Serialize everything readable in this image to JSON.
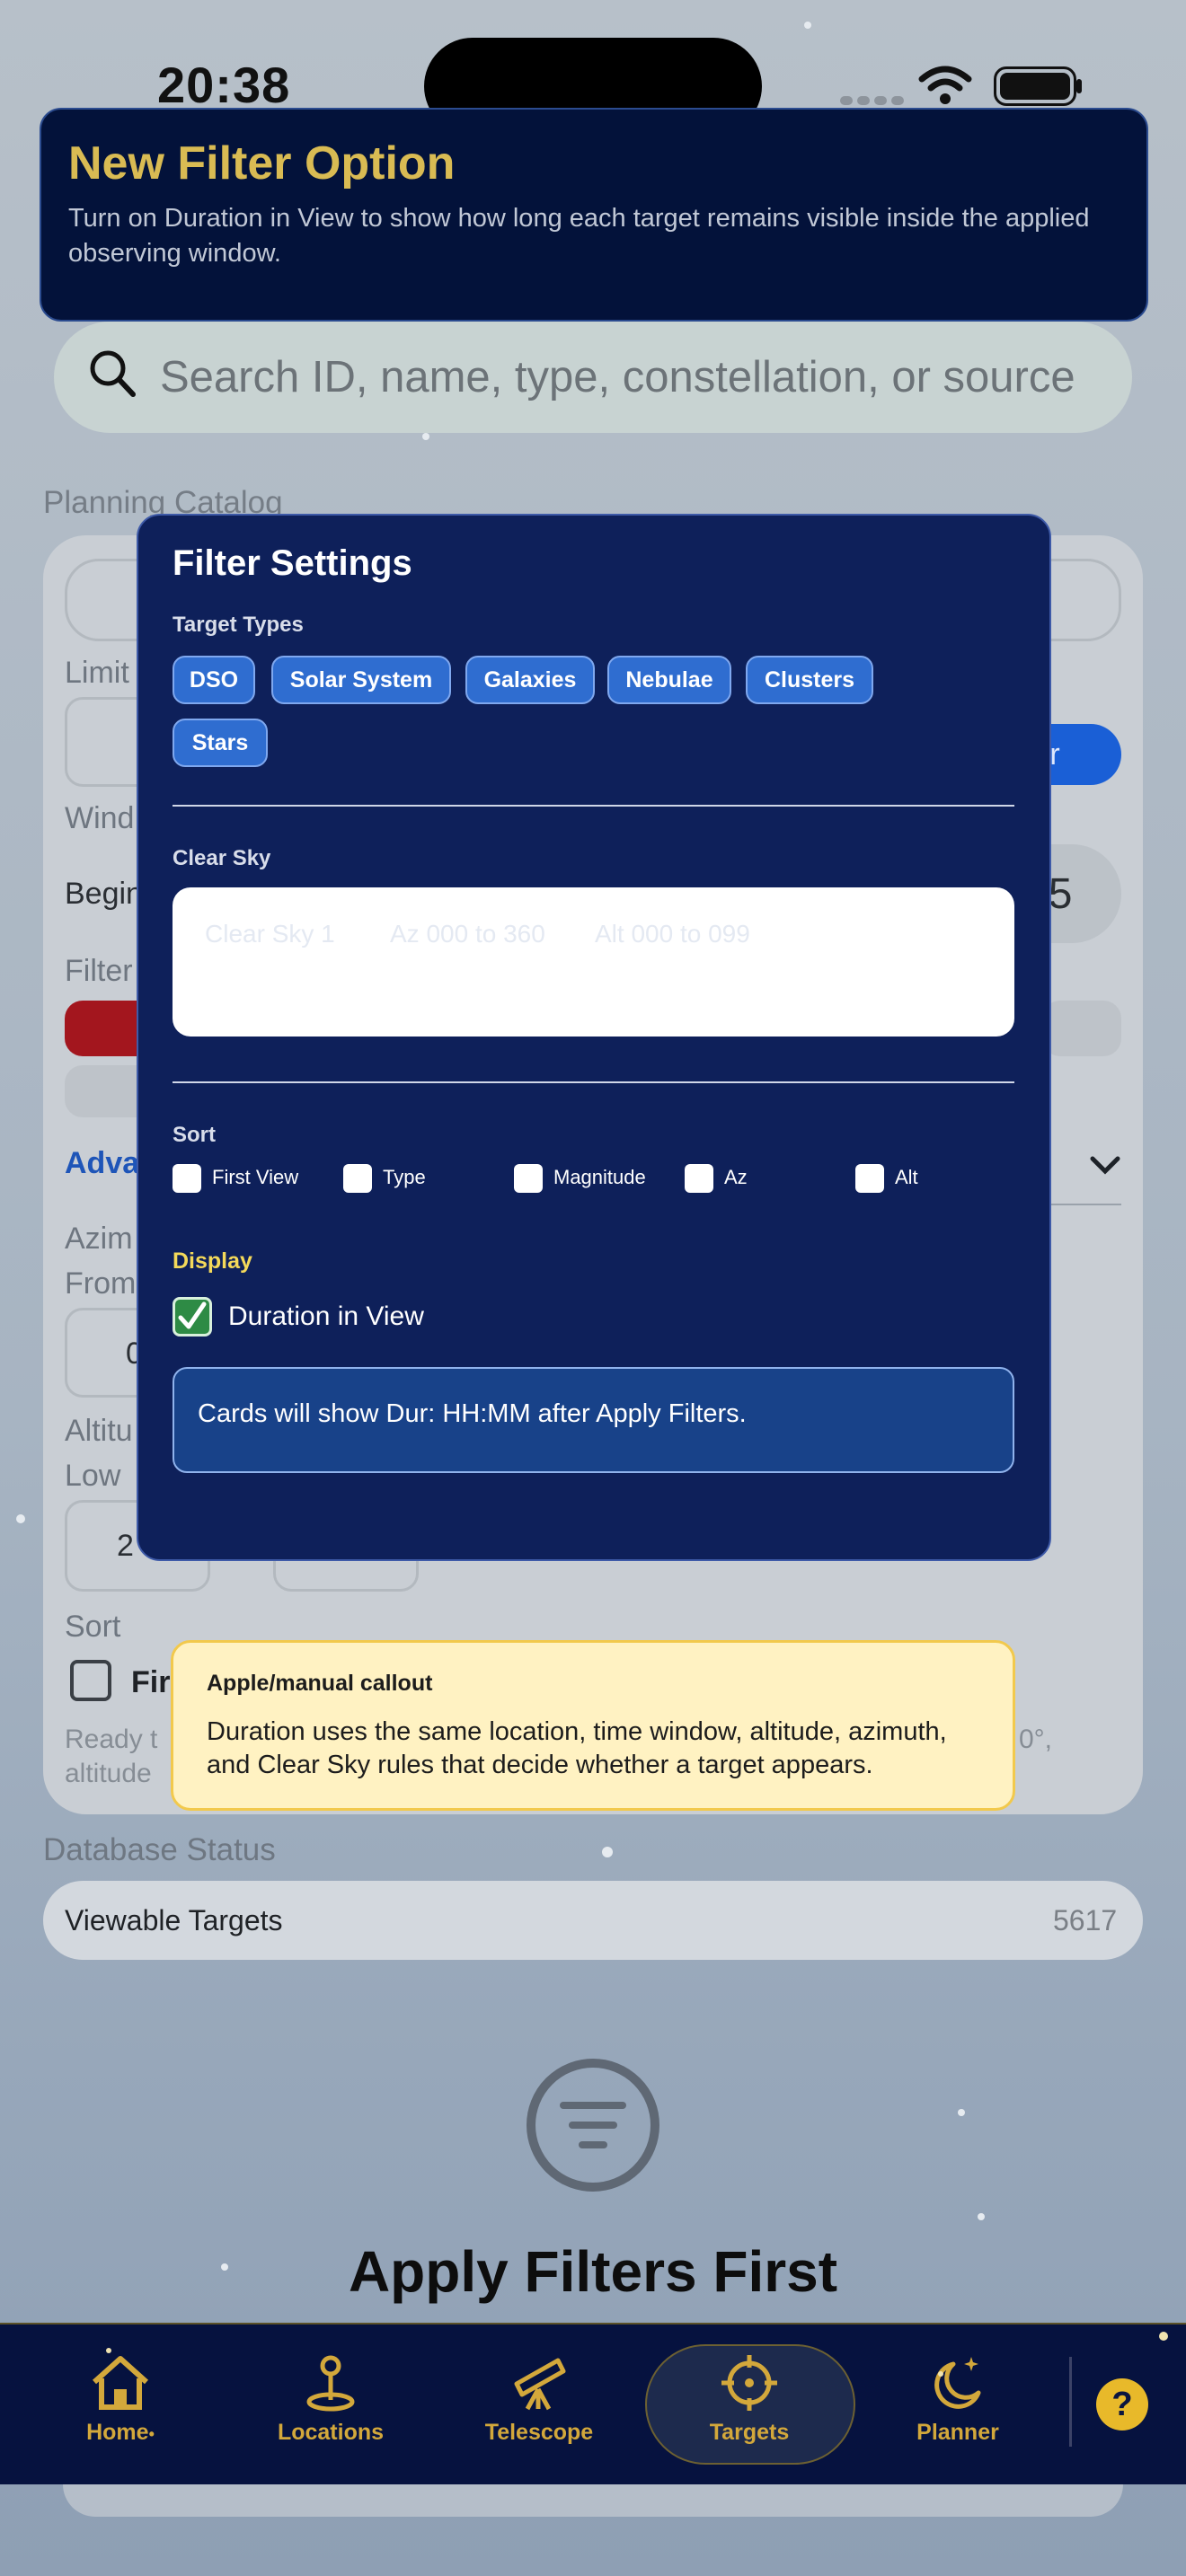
{
  "status_bar": {
    "time": "20:38"
  },
  "banner": {
    "title": "New Filter Option",
    "text": "Turn on Duration in View to show how long each target remains visible inside the applied observing window."
  },
  "search": {
    "placeholder": "Search ID, name, type, constellation, or source"
  },
  "background": {
    "section_title": "Planning Catalog",
    "peek_labels": [
      "Limit",
      "Wind",
      "Begin",
      "Filter",
      "Adva",
      "Azim",
      "From",
      "Altitu",
      "Low",
      "Sort",
      "Fir",
      "Ready t",
      "altitude"
    ],
    "peek_values": [
      "ter",
      "35",
      "0",
      "2",
      "0°,"
    ]
  },
  "modal": {
    "title": "Filter Settings",
    "target_types_label": "Target Types",
    "target_types": [
      "DSO",
      "Solar System",
      "Galaxies",
      "Nebulae",
      "Clusters",
      "Stars"
    ],
    "clear_sky_label": "Clear Sky",
    "clear_sky_hint": [
      "Clear Sky 1",
      "Az 000 to 360",
      "Alt 000 to 099"
    ],
    "sort_label": "Sort",
    "sort_options": [
      "First View",
      "Type",
      "Magnitude",
      "Az",
      "Alt"
    ],
    "display_label": "Display",
    "duration_label": "Duration in View",
    "duration_checked": true,
    "info_text": "Cards will show Dur: HH:MM after Apply Filters."
  },
  "callout": {
    "title": "Apple/manual callout",
    "text": "Duration uses the same location, time window, altitude, azimuth, and Clear Sky rules that decide whether a target appears."
  },
  "database": {
    "title": "Database Status",
    "row_label": "Viewable Targets",
    "row_value": "5617"
  },
  "empty_state": {
    "title": "Apply Filters First"
  },
  "tabs": [
    {
      "label": "Home",
      "badge": "•",
      "icon": "home-icon"
    },
    {
      "label": "Locations",
      "icon": "location-pin-icon"
    },
    {
      "label": "Telescope",
      "icon": "telescope-icon"
    },
    {
      "label": "Targets",
      "icon": "crosshair-icon",
      "active": true
    },
    {
      "label": "Planner",
      "icon": "moon-stars-icon"
    }
  ],
  "help": {
    "label": "?"
  },
  "colors": {
    "accent_gold": "#d3a83b",
    "modal_bg": "#0e205a",
    "chip": "#2f6dd0",
    "callout": "#fff2c2"
  }
}
